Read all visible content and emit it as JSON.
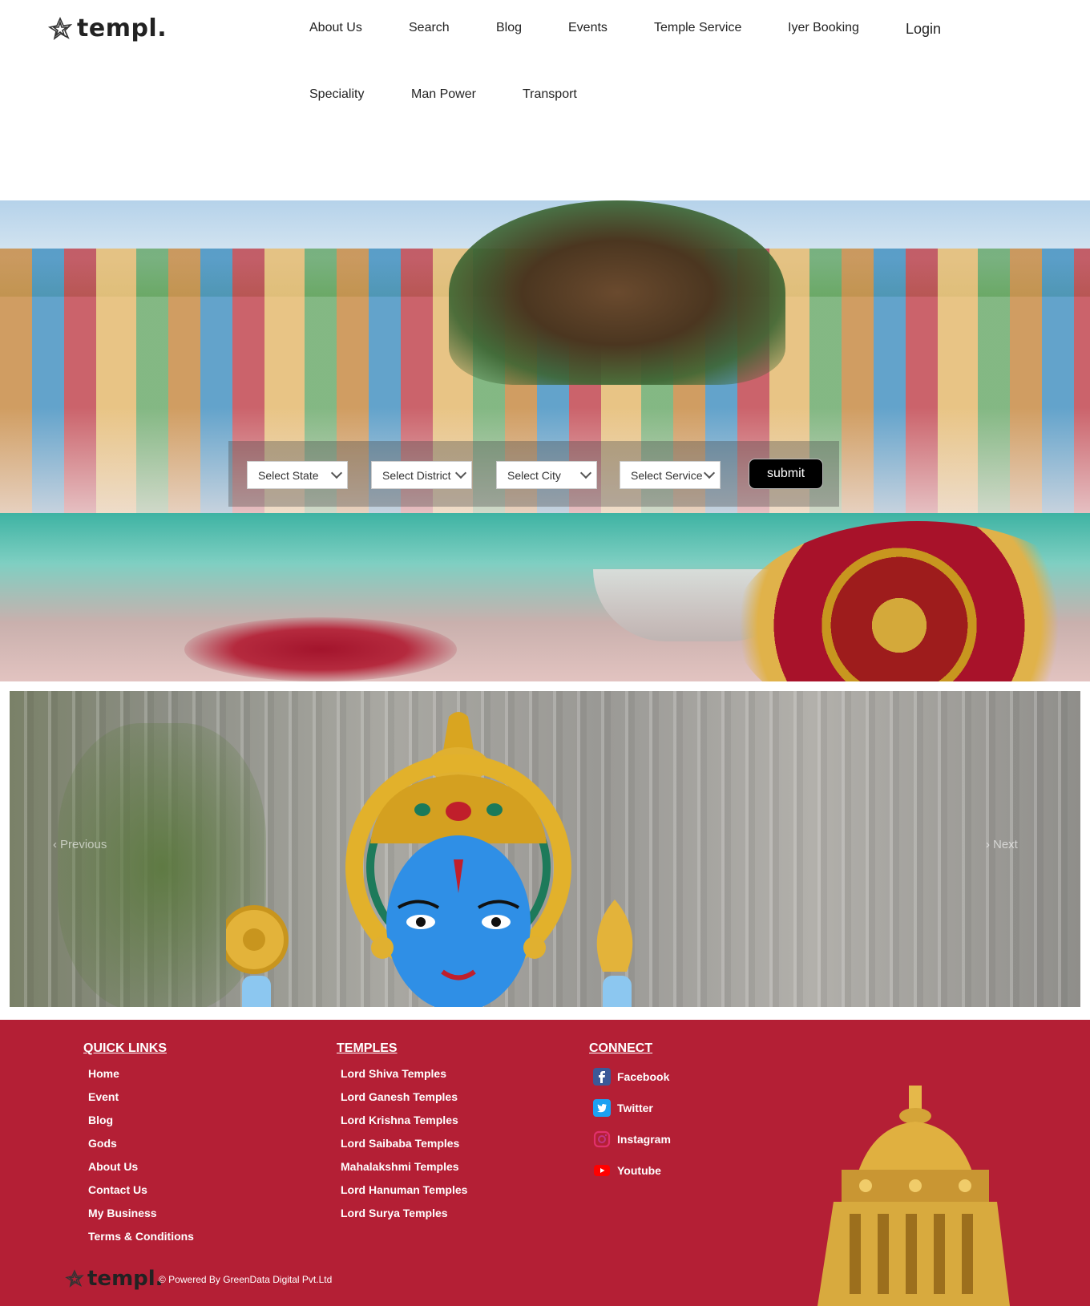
{
  "brand": {
    "name": "templ."
  },
  "nav": {
    "items": [
      "About Us",
      "Search",
      "Blog",
      "Events",
      "Temple Service",
      "Iyer Booking",
      "Speciality",
      "Man Power",
      "Transport"
    ],
    "login": "Login"
  },
  "search": {
    "state": "Select State",
    "district": "Select District",
    "city": "Select City",
    "service": "Select Service",
    "submit": "submit"
  },
  "carousel": {
    "previous": "Previous",
    "next": "Next"
  },
  "footer": {
    "quick_links": {
      "heading": "QUICK LINKS",
      "items": [
        "Home",
        "Event",
        "Blog",
        "Gods",
        "About Us",
        "Contact Us",
        "My Business",
        "Terms & Conditions"
      ]
    },
    "temples": {
      "heading": "TEMPLES",
      "items": [
        "Lord Shiva Temples",
        "Lord Ganesh Temples",
        "Lord Krishna Temples",
        "Lord Saibaba Temples",
        "Mahalakshmi Temples",
        "Lord Hanuman Temples",
        "Lord Surya Temples"
      ]
    },
    "connect": {
      "heading": "CONNECT",
      "items": [
        {
          "label": "Facebook",
          "icon": "facebook-icon",
          "color": "#3b5998"
        },
        {
          "label": "Twitter",
          "icon": "twitter-icon",
          "color": "#1da1f2"
        },
        {
          "label": "Instagram",
          "icon": "instagram-icon",
          "color": "#c13584"
        },
        {
          "label": "Youtube",
          "icon": "youtube-icon",
          "color": "#ff0000"
        }
      ]
    },
    "copyright": "© Powered By GreenData Digital Pvt.Ltd",
    "background_color": "#b41f35"
  }
}
